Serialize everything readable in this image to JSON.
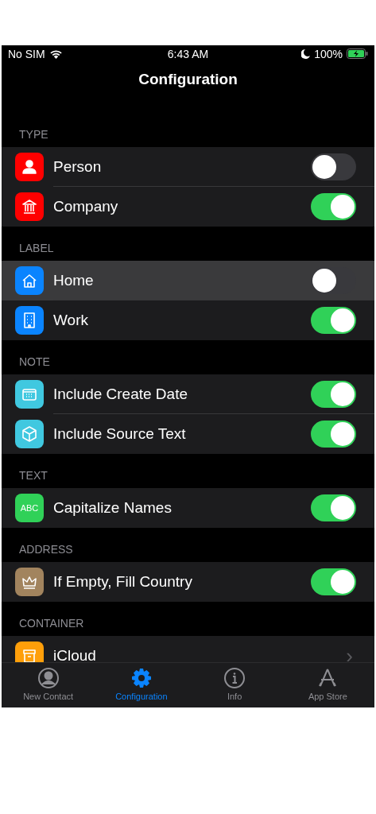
{
  "status_bar": {
    "carrier": "No SIM",
    "time": "6:43 AM",
    "battery": "100%"
  },
  "title": "Configuration",
  "sections": [
    {
      "header": "TYPE",
      "rows": [
        {
          "kind": "toggle",
          "label": "Person",
          "on": false,
          "highlighted": false,
          "color": "#ff0000"
        },
        {
          "kind": "toggle",
          "label": "Company",
          "on": true,
          "highlighted": false,
          "color": "#ff0000"
        }
      ]
    },
    {
      "header": "LABEL",
      "rows": [
        {
          "kind": "toggle",
          "label": "Home",
          "on": false,
          "highlighted": true,
          "color": "#0a84ff"
        },
        {
          "kind": "toggle",
          "label": "Work",
          "on": true,
          "highlighted": false,
          "color": "#0a84ff"
        }
      ]
    },
    {
      "header": "NOTE",
      "rows": [
        {
          "kind": "toggle",
          "label": "Include Create Date",
          "on": true,
          "highlighted": false,
          "color": "#40c8e0"
        },
        {
          "kind": "toggle",
          "label": "Include Source Text",
          "on": true,
          "highlighted": false,
          "color": "#40c8e0"
        }
      ]
    },
    {
      "header": "TEXT",
      "rows": [
        {
          "kind": "toggle",
          "label": "Capitalize Names",
          "on": true,
          "highlighted": false,
          "color": "#30d158",
          "icon_text": "ABC"
        }
      ]
    },
    {
      "header": "ADDRESS",
      "rows": [
        {
          "kind": "toggle",
          "label": "If Empty, Fill Country",
          "on": true,
          "highlighted": false,
          "color": "#a2845e"
        }
      ]
    },
    {
      "header": "CONTAINER",
      "rows": [
        {
          "kind": "disclosure",
          "label": "iCloud",
          "highlighted": false,
          "color": "#ff9f0a",
          "chevron": "›"
        }
      ]
    }
  ],
  "tabs": [
    {
      "label": "New Contact",
      "selected": false
    },
    {
      "label": "Configuration",
      "selected": true
    },
    {
      "label": "Info",
      "selected": false
    },
    {
      "label": "App Store",
      "selected": false
    }
  ]
}
